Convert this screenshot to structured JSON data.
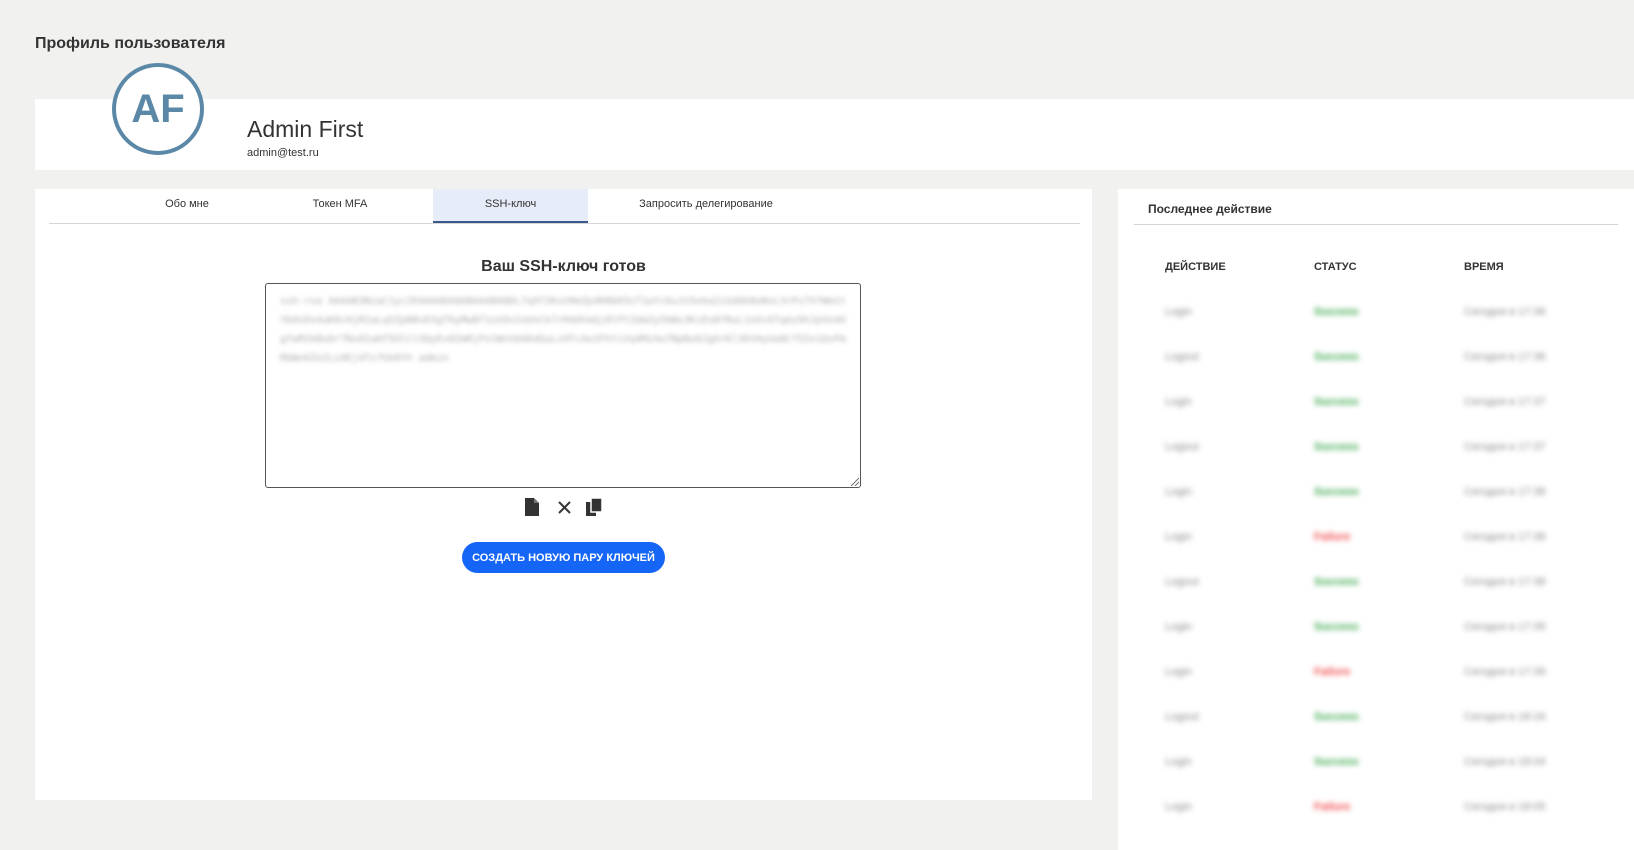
{
  "page_title": "Профиль пользователя",
  "user": {
    "initials": "AF",
    "name": "Admin First",
    "email": "admin@test.ru"
  },
  "tabs": [
    {
      "label": "Обо мне",
      "active": false
    },
    {
      "label": "Токен MFA",
      "active": false
    },
    {
      "label": "SSH-ключ",
      "active": true
    },
    {
      "label": "Запросить делегирование",
      "active": false
    }
  ],
  "ssh": {
    "title": "Ваш SSH-ключ готов",
    "key": "ssh-rsa AAAAB3NzaC1yc2EAAAADAQABAAABAQDL7q9f2KxV0mZp4R8bH3sT1wYc6uJn5eAa2iGdQk8oNvL3rPz7XfWm1tYb9sEe4uK0cHjR2aLq5ZpN8vD3gT6yMwBf1oS9xIeUnCk7rH4dVaQj0lPt2GmZy5bWs3KiEo8fRuL1nXc6TqAz9hJpVe4OgYwM2kBsDr7Nx0IaHf5UlCt3QyEv8ZmRjPo1WnSb6KdGuLx9TcAe2FhYiVq4MzXw7BpNs0JgOrKl3DtHyUa8Cf5Ie1QvPmRbWn6Zo2Ls9Ej4Tx7Gk0Yh admin"
  },
  "create_button_label": "СОЗДАТЬ НОВУЮ ПАРУ КЛЮЧЕЙ",
  "activity": {
    "title": "Последнее действие",
    "columns": [
      "ДЕЙСТВИЕ",
      "СТАТУС",
      "ВРЕМЯ"
    ],
    "rows": [
      {
        "action": "Login",
        "status": "Success",
        "status_color": "#3aa64b",
        "time": "Сегодня в 17:36"
      },
      {
        "action": "Logout",
        "status": "Success",
        "status_color": "#3aa64b",
        "time": "Сегодня в 17:36"
      },
      {
        "action": "Login",
        "status": "Success",
        "status_color": "#3aa64b",
        "time": "Сегодня в 17:37"
      },
      {
        "action": "Logout",
        "status": "Success",
        "status_color": "#3aa64b",
        "time": "Сегодня в 17:37"
      },
      {
        "action": "Login",
        "status": "Success",
        "status_color": "#3aa64b",
        "time": "Сегодня в 17:38"
      },
      {
        "action": "Login",
        "status": "Failure",
        "status_color": "#f04848",
        "time": "Сегодня в 17:38"
      },
      {
        "action": "Logout",
        "status": "Success",
        "status_color": "#3aa64b",
        "time": "Сегодня в 17:38"
      },
      {
        "action": "Login",
        "status": "Success",
        "status_color": "#3aa64b",
        "time": "Сегодня в 17:39"
      },
      {
        "action": "Login",
        "status": "Failure",
        "status_color": "#f04848",
        "time": "Сегодня в 17:39"
      },
      {
        "action": "Logout",
        "status": "Success",
        "status_color": "#3aa64b",
        "time": "Сегодня в 18:16"
      },
      {
        "action": "Login",
        "status": "Success",
        "status_color": "#3aa64b",
        "time": "Сегодня в 18:04"
      },
      {
        "action": "Login",
        "status": "Failure",
        "status_color": "#f04848",
        "time": "Сегодня в 18:05"
      }
    ]
  },
  "colors": {
    "accent": "#1565f6",
    "avatar": "#5a88a6",
    "tab_active_bg": "#e6ecf8"
  }
}
